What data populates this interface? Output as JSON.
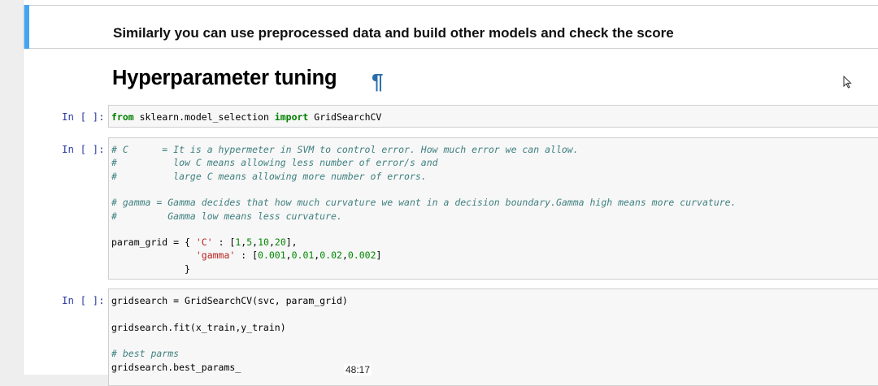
{
  "markdown_cell": {
    "text": "Similarly you can use preprocessed data and build other models and check the score"
  },
  "heading": {
    "text": "Hyperparameter tuning",
    "anchor": "¶"
  },
  "cells": [
    {
      "prompt": "In [ ]:",
      "lines": [
        [
          {
            "t": "from",
            "c": "kw"
          },
          {
            "t": " sklearn.model_selection ",
            "c": ""
          },
          {
            "t": "import",
            "c": "kw"
          },
          {
            "t": " GridSearchCV",
            "c": ""
          }
        ]
      ]
    },
    {
      "prompt": "In [ ]:",
      "lines": [
        [
          {
            "t": "# C      = It is a hypermeter in SVM to control error. How much error we can allow.",
            "c": "cm"
          }
        ],
        [
          {
            "t": "#          low C means allowing less number of error/s and",
            "c": "cm"
          }
        ],
        [
          {
            "t": "#          large C means allowing more number of errors.",
            "c": "cm"
          }
        ],
        [],
        [
          {
            "t": "# gamma = Gamma decides that how much curvature we want in a decision boundary.Gamma high means more curvature.",
            "c": "cm"
          }
        ],
        [
          {
            "t": "#         Gamma low means less curvature.",
            "c": "cm"
          }
        ],
        [],
        [
          {
            "t": "param_grid = { ",
            "c": ""
          },
          {
            "t": "'C'",
            "c": "st"
          },
          {
            "t": " : [",
            "c": ""
          },
          {
            "t": "1",
            "c": "nu"
          },
          {
            "t": ",",
            "c": ""
          },
          {
            "t": "5",
            "c": "nu"
          },
          {
            "t": ",",
            "c": ""
          },
          {
            "t": "10",
            "c": "nu"
          },
          {
            "t": ",",
            "c": ""
          },
          {
            "t": "20",
            "c": "nu"
          },
          {
            "t": "],",
            "c": ""
          }
        ],
        [
          {
            "t": "               ",
            "c": ""
          },
          {
            "t": "'gamma'",
            "c": "st"
          },
          {
            "t": " : [",
            "c": ""
          },
          {
            "t": "0.001",
            "c": "nu"
          },
          {
            "t": ",",
            "c": ""
          },
          {
            "t": "0.01",
            "c": "nu"
          },
          {
            "t": ",",
            "c": ""
          },
          {
            "t": "0.02",
            "c": "nu"
          },
          {
            "t": ",",
            "c": ""
          },
          {
            "t": "0.002",
            "c": "nu"
          },
          {
            "t": "]",
            "c": ""
          }
        ],
        [
          {
            "t": "             }",
            "c": ""
          }
        ]
      ]
    },
    {
      "prompt": "In [ ]:",
      "lines": [
        [
          {
            "t": "gridsearch = GridSearchCV(svc, param_grid)",
            "c": ""
          }
        ],
        [],
        [
          {
            "t": "gridsearch.fit(x_train,y_train)",
            "c": ""
          }
        ],
        [],
        [
          {
            "t": "# best parms",
            "c": "cm"
          }
        ],
        [
          {
            "t": "gridsearch.best_params_",
            "c": ""
          }
        ]
      ]
    }
  ],
  "timestamp": "48:17"
}
